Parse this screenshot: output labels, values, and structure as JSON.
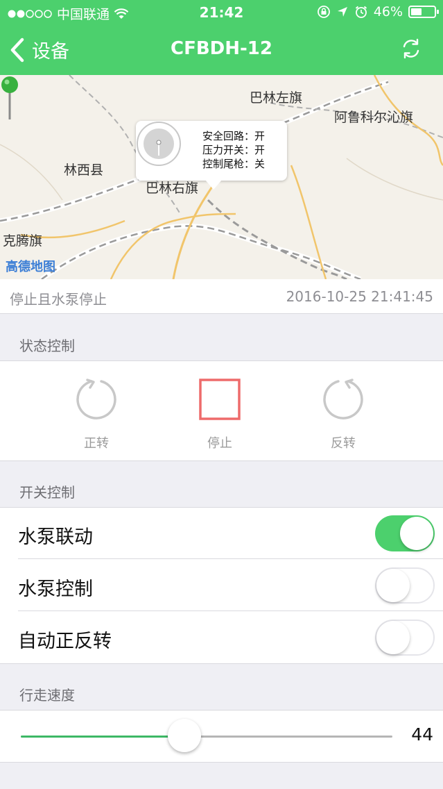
{
  "status_bar": {
    "carrier": "中国联通",
    "time": "21:42",
    "battery_text": "46%",
    "battery_level": 0.46
  },
  "nav": {
    "back_label": "设备",
    "title": "CFBDH-12"
  },
  "map": {
    "labels": [
      "巴林左旗",
      "阿鲁科尔沁旗",
      "林西县",
      "巴林右旗",
      "克腾旗"
    ],
    "brand": "高德地图",
    "callout_lines": [
      "安全回路：开",
      "压力开关：开",
      "控制尾枪：关"
    ]
  },
  "device_status": {
    "text": "停止且水泵停止",
    "timestamp": "2016-10-25 21:41:45"
  },
  "state_control": {
    "header": "状态控制",
    "buttons": [
      "正转",
      "停止",
      "反转"
    ],
    "active_color": "#ee6b6b"
  },
  "switch_control": {
    "header": "开关控制",
    "items": [
      {
        "label": "水泵联动",
        "on": true
      },
      {
        "label": "水泵控制",
        "on": false
      },
      {
        "label": "自动正反转",
        "on": false
      }
    ]
  },
  "speed": {
    "header": "行走速度",
    "value": 44,
    "value_text": "44",
    "min": 0,
    "max": 100
  },
  "colors": {
    "brand_green": "#4cd06d",
    "slider_green": "#3db865"
  }
}
